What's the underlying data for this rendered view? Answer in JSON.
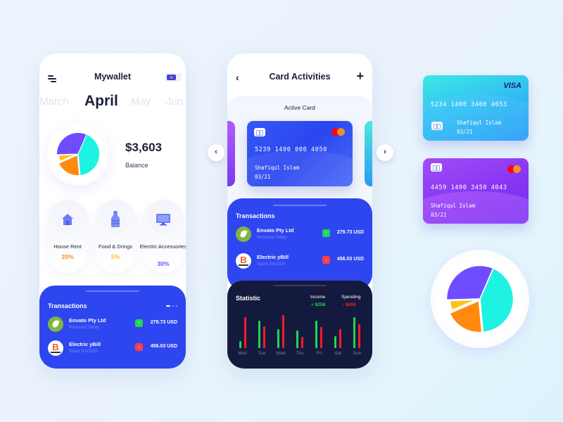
{
  "wallet_screen": {
    "title": "Mywallet",
    "months": [
      "March",
      "April",
      "May",
      "Jun"
    ],
    "selected_month": "April",
    "balance": {
      "amount": "$3,603",
      "label": "Balance"
    },
    "pie_slices": [
      {
        "name": "cyan",
        "color": "#1ef2e3",
        "share": 0.42
      },
      {
        "name": "orange",
        "color": "#ff8a0f",
        "share": 0.2
      },
      {
        "name": "yellow",
        "color": "#ffc21a",
        "share": 0.06
      },
      {
        "name": "purple",
        "color": "#6f4cff",
        "share": 0.32
      }
    ],
    "categories": [
      {
        "label": "House Rent",
        "percent": "20%",
        "color": "#ff8a0f",
        "icon": "house-icon"
      },
      {
        "label": "Food & Drings",
        "percent": "5%",
        "color": "#ffc21a",
        "icon": "bottle-icon"
      },
      {
        "label": "Electric Accessories",
        "percent": "30%",
        "color": "#6f4cff",
        "icon": "monitor-icon"
      }
    ],
    "transactions_title": "Transactions",
    "transactions": [
      {
        "name": "Envato Pty Ltd",
        "sub": "Received  Today",
        "direction": "up",
        "amount": "279.73 USD",
        "logo": "envato-logo"
      },
      {
        "name": "Electric yBill",
        "sub": "Spent 3/4/2020",
        "direction": "down",
        "amount": "456.03 USD",
        "logo": "bill-logo"
      }
    ]
  },
  "card_screen": {
    "title": "Card Activities",
    "back_icon": "‹",
    "add_icon": "+",
    "active_card_label": "Active Card",
    "active_card": {
      "number": "5239 1400 000 4050",
      "holder": "Shafiqul Islam",
      "expiry": "03/21",
      "brand": "mastercard"
    },
    "prev_arrow": "‹",
    "next_arrow": "›",
    "transactions_title": "Transactions",
    "transactions": [
      {
        "name": "Envato Pty Ltd",
        "sub": "Received  Today",
        "direction": "up",
        "amount": "279.73 USD"
      },
      {
        "name": "Electric yBill",
        "sub": "Spent 3/4/2020",
        "direction": "down",
        "amount": "456.03 USD"
      }
    ],
    "statistic": {
      "title": "Statistic",
      "income_label": "Income",
      "income_value": "+ $258",
      "spending_label": "Spending",
      "spending_value": "- $658",
      "income_color": "#1fd655",
      "spending_color": "#ff1a2a"
    }
  },
  "chart_data": {
    "type": "bar",
    "title": "Statistic",
    "categories": [
      "Mon",
      "Tue",
      "Wed",
      "Thu",
      "Fri",
      "Sat",
      "Sun"
    ],
    "series": [
      {
        "name": "Income",
        "values": [
          10,
          37,
          26,
          24,
          37,
          16,
          42
        ]
      },
      {
        "name": "Spending",
        "values": [
          42,
          30,
          45,
          15,
          29,
          26,
          33
        ]
      }
    ],
    "ylim": [
      0,
      46
    ],
    "grid": false,
    "legend": "top-right"
  },
  "showcase": {
    "visa_card": {
      "number": "5234 1400 3400 4053",
      "holder": "Shafiqul Islam",
      "expiry": "03/21",
      "brand": "VISA"
    },
    "mastercard_card": {
      "number": "4459 1400 3450 4043",
      "holder": "Shafiqul Islam",
      "expiry": "03/21",
      "brand": "mastercard"
    }
  },
  "arrows": {
    "up": "↑",
    "down": "↓"
  }
}
